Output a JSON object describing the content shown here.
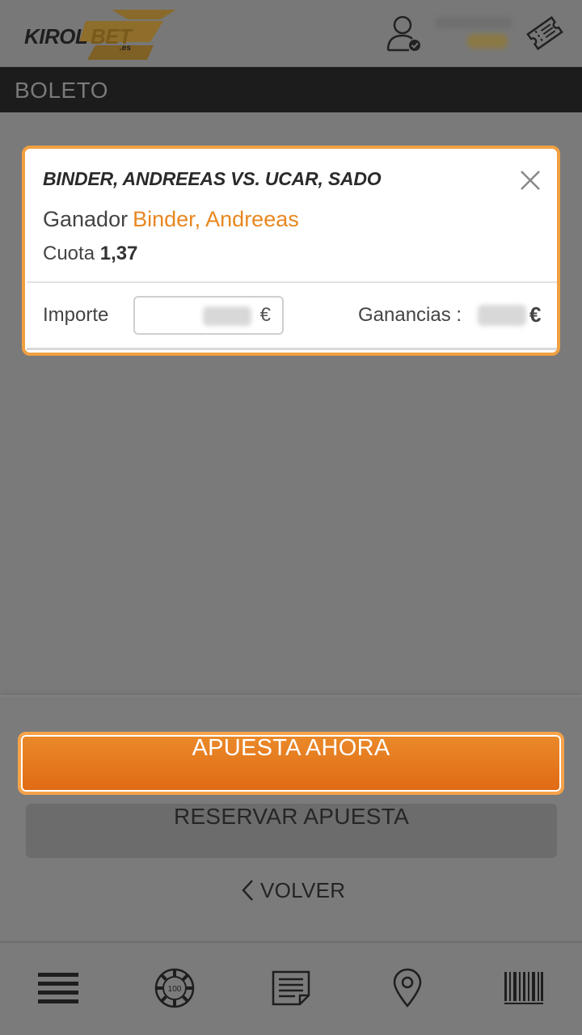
{
  "header": {
    "logo": {
      "brand_main": "KIROL",
      "brand_accent": "BET",
      "brand_tld": ".es"
    },
    "icons": {
      "user": "user-check-icon",
      "ticket": "ticket-icon"
    },
    "colors": {
      "brand_orange": "#e88720",
      "header_bg": "#787878"
    }
  },
  "section": {
    "title": "BOLETO"
  },
  "bet": {
    "match": "BINDER, ANDREEAS VS. UCAR, SADO",
    "market_label": "Ganador",
    "selection": "Binder, Andreeas",
    "odds_label": "Cuota",
    "odds_value": "1,37",
    "stake_label": "Importe",
    "stake_currency": "€",
    "winnings_label": "Ganancias :",
    "winnings_currency": "€"
  },
  "actions": {
    "bet_now": "APUESTA AHORA",
    "reserve": "RESERVAR APUESTA",
    "back": "VOLVER",
    "colors": {
      "primary_start": "#ea8a2a",
      "primary_end": "#e06a14"
    }
  },
  "nav": {
    "items": [
      {
        "name": "menu",
        "icon": "menu-icon"
      },
      {
        "name": "casino",
        "icon": "casino-chip-icon",
        "chip_label": "100"
      },
      {
        "name": "bet-history",
        "icon": "document-icon"
      },
      {
        "name": "locations",
        "icon": "map-pin-icon"
      },
      {
        "name": "barcode",
        "icon": "barcode-icon"
      }
    ]
  }
}
